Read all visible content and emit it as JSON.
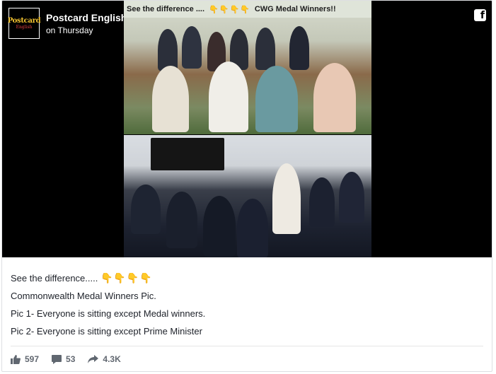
{
  "header": {
    "page_name": "Postcard English",
    "post_time": "on Thursday",
    "avatar_text": "Postcard",
    "avatar_subtext": "English",
    "facebook_icon": "f"
  },
  "image": {
    "caption": "See the difference ....",
    "caption_right": "CWG Medal Winners!!"
  },
  "post": {
    "line1": "See the difference.....",
    "line1_emoji": "👇👇👇👇",
    "line2": "Commonwealth Medal Winners Pic.",
    "line3": "Pic 1- Everyone is sitting except Medal winners.",
    "line4": "Pic 2- Everyone is sitting except Prime Minister"
  },
  "stats": {
    "likes": "597",
    "comments": "53",
    "shares": "4.3K"
  },
  "colors": {
    "media_bg": "#000000",
    "text": "#1d2129",
    "stat_text": "#616770",
    "emoji": "#e8a92b"
  }
}
